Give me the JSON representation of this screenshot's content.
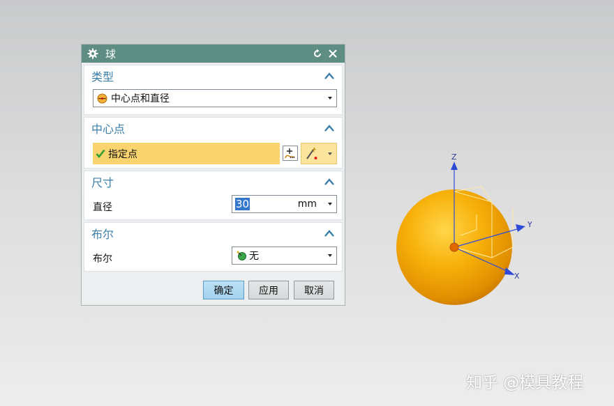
{
  "dialog": {
    "title": "球",
    "sections": {
      "type": {
        "title": "类型",
        "dropdown_value": "中心点和直径"
      },
      "center": {
        "title": "中心点",
        "specify_label": "指定点"
      },
      "size": {
        "title": "尺寸",
        "diameter_label": "直径",
        "diameter_value": "30",
        "unit": "mm"
      },
      "boolean": {
        "title": "布尔",
        "boolean_label": "布尔",
        "boolean_value": "无"
      }
    },
    "buttons": {
      "ok": "确定",
      "apply": "应用",
      "cancel": "取消"
    }
  },
  "viewport": {
    "axes": {
      "z": "Z",
      "y": "Y",
      "x": "X"
    },
    "sphere_color": "#f5a500"
  },
  "watermark": "知乎 @模具教程",
  "colors": {
    "titlebar": "#5e8e83",
    "section_title": "#3c7ea8",
    "highlight_row": "#f9d46e"
  }
}
